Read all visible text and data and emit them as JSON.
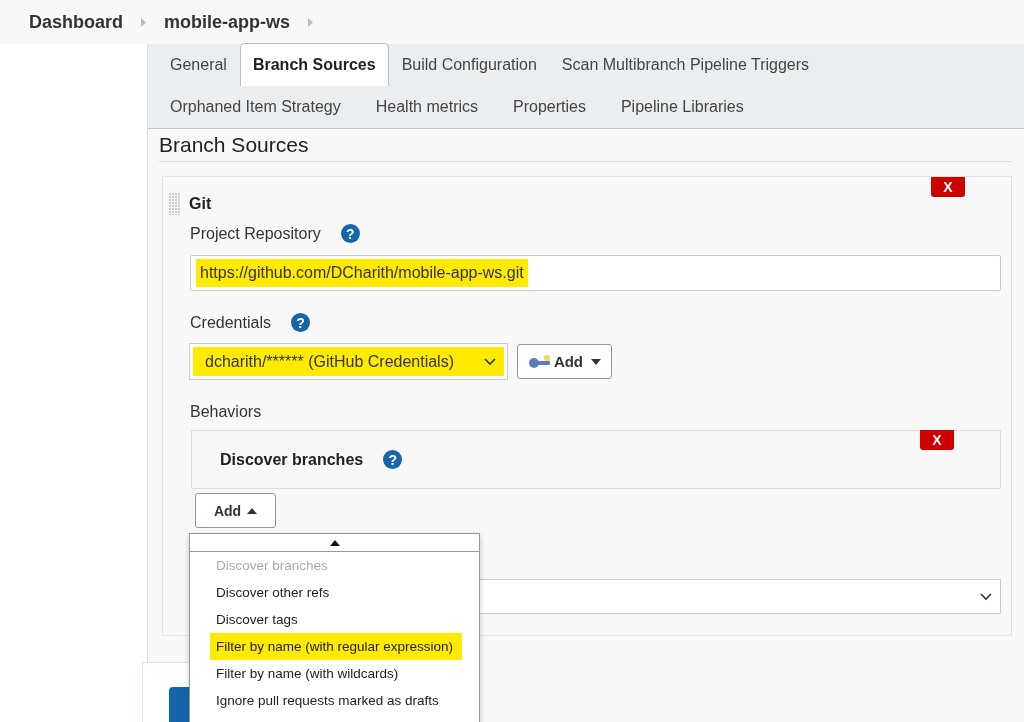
{
  "breadcrumbs": [
    {
      "label": "Dashboard"
    },
    {
      "label": "mobile-app-ws"
    }
  ],
  "tabs": [
    [
      {
        "label": "General",
        "selected": false
      },
      {
        "label": "Branch Sources",
        "selected": true
      },
      {
        "label": "Build Configuration",
        "selected": false
      },
      {
        "label": "Scan Multibranch Pipeline Triggers",
        "selected": false
      }
    ],
    [
      {
        "label": "Orphaned Item Strategy",
        "selected": false
      },
      {
        "label": "Health metrics",
        "selected": false
      },
      {
        "label": "Properties",
        "selected": false
      },
      {
        "label": "Pipeline Libraries",
        "selected": false
      }
    ]
  ],
  "section_title": "Branch Sources",
  "source": {
    "title": "Git",
    "delete_label": "X",
    "repository": {
      "label": "Project Repository",
      "help": "?",
      "value": "https://github.com/DCharith/mobile-app-ws.git",
      "highlighted": true
    },
    "credentials": {
      "label": "Credentials",
      "help": "?",
      "value": "dcharith/****** (GitHub Credentials)",
      "highlighted": true,
      "add_label": "Add"
    },
    "behaviors_label": "Behaviors",
    "behaviors": [
      {
        "title": "Discover branches",
        "help": "?",
        "delete_label": "X"
      }
    ],
    "add_behavior_label": "Add"
  },
  "behavior_menu": [
    {
      "label": "Discover branches",
      "disabled": true,
      "selected": false
    },
    {
      "label": "Discover other refs",
      "disabled": false,
      "selected": false
    },
    {
      "label": "Discover tags",
      "disabled": false,
      "selected": false
    },
    {
      "label": "Filter by name (with regular expression)",
      "disabled": false,
      "selected": true
    },
    {
      "label": "Filter by name (with wildcards)",
      "disabled": false,
      "selected": false
    },
    {
      "label": "Ignore pull requests marked as drafts",
      "disabled": false,
      "selected": false
    }
  ]
}
